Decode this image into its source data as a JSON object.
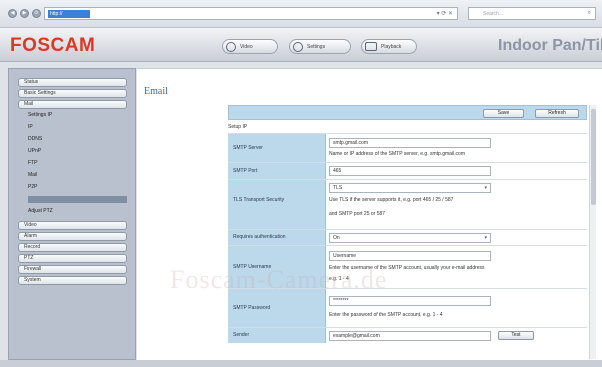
{
  "browser": {
    "nav": [
      "◀",
      "▶",
      "⟳"
    ],
    "url": "http://",
    "url_icons": "▾ ⟳ ✕",
    "search_placeholder": "Search...",
    "search_icon": "search-icon"
  },
  "header": {
    "logo": "FOSCAM",
    "tabs": [
      {
        "label": "Video",
        "icon": "play-icon"
      },
      {
        "label": "Settings",
        "icon": "gear-icon"
      },
      {
        "label": "Playback",
        "icon": "folder-icon"
      }
    ],
    "model_title": "Indoor Pan/Tilt"
  },
  "sidebar": {
    "items": [
      {
        "label": "Status"
      },
      {
        "label": "Basic Settings"
      },
      {
        "label": "Mail"
      }
    ],
    "sub_items": [
      "Settings IP",
      "IP",
      "DDNS",
      "UPnP",
      "FTP",
      "Mail",
      "P2P",
      "",
      "Adjust PTZ"
    ],
    "items_lower": [
      {
        "label": "Video"
      },
      {
        "label": "Alarm"
      },
      {
        "label": "Record"
      },
      {
        "label": "PTZ"
      },
      {
        "label": "Firewall"
      },
      {
        "label": "System"
      }
    ]
  },
  "content": {
    "title": "Email",
    "toolbar": {
      "save_label": "Save",
      "refresh_label": "Refresh"
    },
    "section_label": "Setup IP",
    "rows": [
      {
        "label": "SMTP Server",
        "value": "smtp.gmail.com",
        "hint": "Name or IP address of the SMTP server, e.g. smtp.gmail.com"
      },
      {
        "label": "SMTP Port",
        "value": "465"
      },
      {
        "label": "TLS Transport Security",
        "value": "TLS",
        "hint": "Use TLS if the server supports it, e.g. port 465 / 25 / 587",
        "hint2": "and SMTP port 25 or 587"
      },
      {
        "label": "Requires authentication",
        "value": "On"
      },
      {
        "label": "SMTP Username",
        "value": "Username",
        "hint": "Enter the username of the SMTP account, usually your e-mail address",
        "hint2": "e.g. 1 - 4"
      },
      {
        "label": "SMTP Password",
        "value": "********",
        "hint": "Enter the password of the SMTP account, e.g. 1 - 4"
      },
      {
        "label": "Sender",
        "value": "example@gmail.com",
        "button": "Test"
      }
    ]
  },
  "watermark": "Foscam-Camera.de",
  "colors": {
    "brand": "#d93a22",
    "label_bg": "#bcd9ec",
    "title": "#3a6ea8"
  }
}
